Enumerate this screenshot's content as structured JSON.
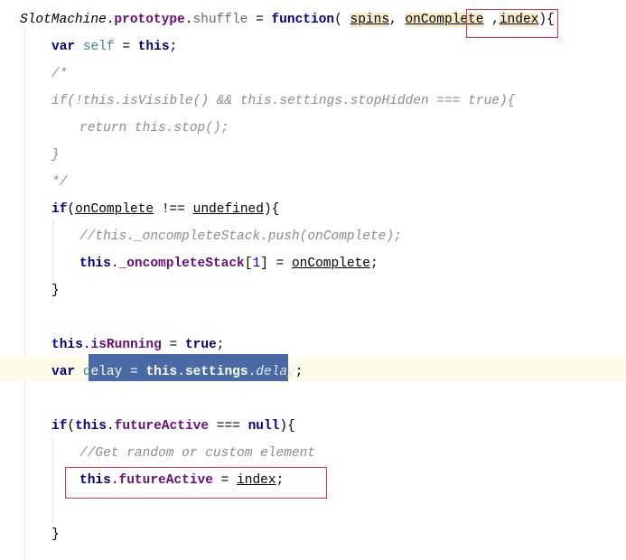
{
  "editor": {
    "lines": [
      {
        "indent": 0,
        "tokens": [
          {
            "t": "SlotMachine",
            "c": "it"
          },
          {
            "t": ".",
            "c": ""
          },
          {
            "t": "prototype",
            "c": "prop"
          },
          {
            "t": ".",
            "c": ""
          },
          {
            "t": "shuffle",
            "c": "fn"
          },
          {
            "t": " = ",
            "c": ""
          },
          {
            "t": "function",
            "c": "kw"
          },
          {
            "t": "( ",
            "c": ""
          },
          {
            "t": "spins",
            "c": "param hl"
          },
          {
            "t": ", ",
            "c": ""
          },
          {
            "t": "onComplete",
            "c": "param hl"
          },
          {
            "t": " ,",
            "c": ""
          },
          {
            "t": "index",
            "c": "param hl"
          },
          {
            "t": "){",
            "c": ""
          }
        ]
      },
      {
        "indent": 1,
        "tokens": [
          {
            "t": "var ",
            "c": "kw"
          },
          {
            "t": "self",
            "c": "loc"
          },
          {
            "t": " = ",
            "c": ""
          },
          {
            "t": "this",
            "c": "kw"
          },
          {
            "t": ";",
            "c": ""
          }
        ]
      },
      {
        "indent": 1,
        "tokens": [
          {
            "t": "/*",
            "c": "cm"
          }
        ]
      },
      {
        "indent": 1,
        "tokens": [
          {
            "t": "if(!this.isVisible() && this.settings.stopHidden === true){",
            "c": "cm"
          }
        ]
      },
      {
        "indent": 2,
        "tokens": [
          {
            "t": "return this.stop();",
            "c": "cm"
          }
        ]
      },
      {
        "indent": 1,
        "tokens": [
          {
            "t": "}",
            "c": "cm"
          }
        ]
      },
      {
        "indent": 1,
        "tokens": [
          {
            "t": "*/",
            "c": "cm"
          }
        ]
      },
      {
        "indent": 1,
        "tokens": [
          {
            "t": "if",
            "c": "kw"
          },
          {
            "t": "(",
            "c": ""
          },
          {
            "t": "onComplete",
            "c": "param"
          },
          {
            "t": " !== ",
            "c": ""
          },
          {
            "t": "undefined",
            "c": "param"
          },
          {
            "t": "){",
            "c": ""
          }
        ]
      },
      {
        "indent": 2,
        "tokens": [
          {
            "t": "//this._oncompleteStack.push(onComplete);",
            "c": "cm"
          }
        ]
      },
      {
        "indent": 2,
        "tokens": [
          {
            "t": "this",
            "c": "kw"
          },
          {
            "t": ".",
            "c": ""
          },
          {
            "t": "_oncompleteStack",
            "c": "prop"
          },
          {
            "t": "[",
            "c": ""
          },
          {
            "t": "1",
            "c": "num"
          },
          {
            "t": "] = ",
            "c": ""
          },
          {
            "t": "onComplete",
            "c": "param"
          },
          {
            "t": ";",
            "c": ""
          }
        ]
      },
      {
        "indent": 1,
        "tokens": [
          {
            "t": "}",
            "c": ""
          }
        ]
      },
      {
        "indent": 1,
        "tokens": []
      },
      {
        "indent": 1,
        "tokens": [
          {
            "t": "this",
            "c": "kw"
          },
          {
            "t": ".",
            "c": ""
          },
          {
            "t": "isRunning",
            "c": "prop"
          },
          {
            "t": " = ",
            "c": ""
          },
          {
            "t": "true",
            "c": "kw"
          },
          {
            "t": ";",
            "c": ""
          }
        ]
      },
      {
        "indent": 1,
        "tokens": [
          {
            "t": "var ",
            "c": "kw"
          },
          {
            "t": "d",
            "c": "loc"
          },
          {
            "t": "elay",
            "c": "selt"
          },
          {
            "t": " = ",
            "c": "selt"
          },
          {
            "t": "this",
            "c": "kw selt"
          },
          {
            "t": ".",
            "c": "selt"
          },
          {
            "t": "settings",
            "c": "prop selt"
          },
          {
            "t": ".",
            "c": "selt"
          },
          {
            "t": "delay",
            "c": "it selt"
          },
          {
            "t": ";",
            "c": ""
          }
        ]
      },
      {
        "indent": 1,
        "tokens": []
      },
      {
        "indent": 1,
        "tokens": [
          {
            "t": "if",
            "c": "kw"
          },
          {
            "t": "(",
            "c": ""
          },
          {
            "t": "this",
            "c": "kw"
          },
          {
            "t": ".",
            "c": ""
          },
          {
            "t": "futureActive",
            "c": "prop"
          },
          {
            "t": " === ",
            "c": ""
          },
          {
            "t": "null",
            "c": "kw"
          },
          {
            "t": "){",
            "c": ""
          }
        ]
      },
      {
        "indent": 2,
        "tokens": [
          {
            "t": "//Get random or custom element",
            "c": "cm"
          }
        ]
      },
      {
        "indent": 2,
        "tokens": [
          {
            "t": "this",
            "c": "kw"
          },
          {
            "t": ".",
            "c": ""
          },
          {
            "t": "futureActive",
            "c": "prop"
          },
          {
            "t": " = ",
            "c": ""
          },
          {
            "t": "index",
            "c": "param"
          },
          {
            "t": ";",
            "c": ""
          }
        ]
      },
      {
        "indent": 1,
        "tokens": []
      },
      {
        "indent": 1,
        "tokens": [
          {
            "t": "}",
            "c": ""
          }
        ]
      }
    ],
    "colors": {
      "keyword": "#000080",
      "property": "#660e7a",
      "comment": "#8c8c8c",
      "selection": "#4a6aa5",
      "current_line": "#fefbe9",
      "annotation_box": "#d9344a"
    }
  }
}
